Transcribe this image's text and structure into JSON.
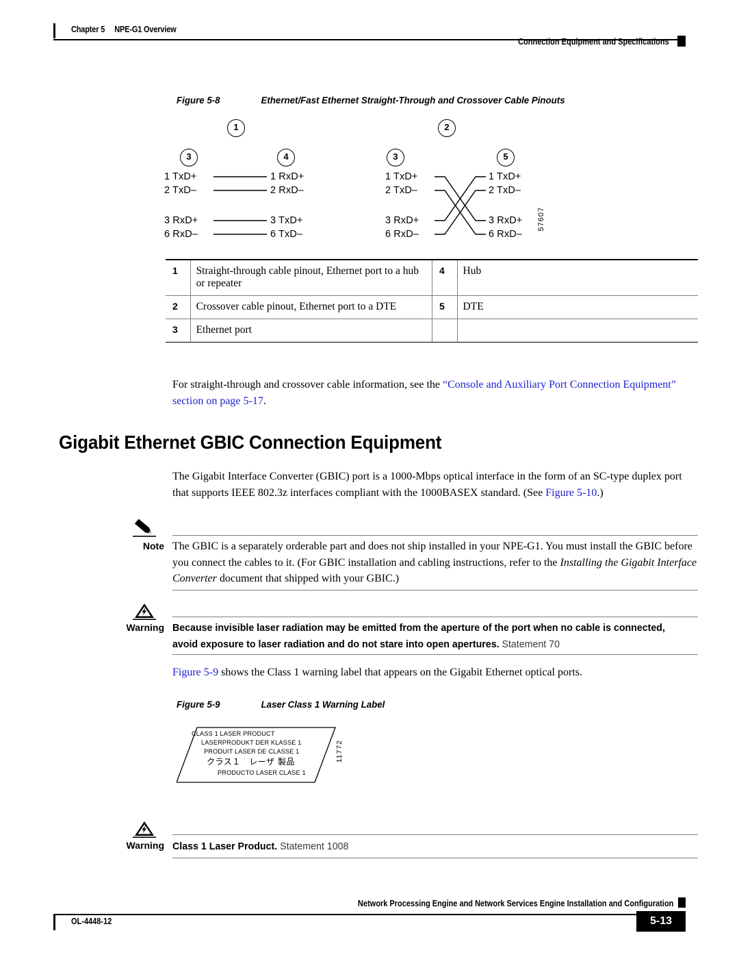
{
  "header": {
    "chapter": "Chapter 5",
    "chapter_title": "NPE-G1 Overview",
    "section": "Connection Equipment and Specifications"
  },
  "figure_58": {
    "number": "Figure 5-8",
    "title": "Ethernet/Fast Ethernet Straight-Through and Crossover Cable Pinouts",
    "artwork_id": "57607",
    "callouts": {
      "straight_through": "1",
      "crossover": "2",
      "left_port_a": "3",
      "right_hub": "4",
      "left_port_b": "3",
      "right_dte": "5"
    },
    "straight_through_pairs": [
      {
        "left": "1 TxD+",
        "right": "1 RxD+"
      },
      {
        "left": "2 TxD–",
        "right": "2 RxD–"
      },
      {
        "left": "3 RxD+",
        "right": "3 TxD+"
      },
      {
        "left": "6 RxD–",
        "right": "6 TxD–"
      }
    ],
    "crossover_pairs": [
      {
        "left": "1 TxD+",
        "right": "1 TxD+"
      },
      {
        "left": "2 TxD–",
        "right": "2 TxD–"
      },
      {
        "left": "3 RxD+",
        "right": "3 RxD+"
      },
      {
        "left": "6 RxD–",
        "right": "6 RxD–"
      }
    ],
    "legend": [
      {
        "n1": "1",
        "t1": "Straight-through cable pinout, Ethernet port to a hub or repeater",
        "n2": "4",
        "t2": "Hub"
      },
      {
        "n1": "2",
        "t1": "Crossover cable pinout, Ethernet port to a DTE",
        "n2": "5",
        "t2": "DTE"
      },
      {
        "n1": "3",
        "t1": "Ethernet port",
        "n2": "",
        "t2": ""
      }
    ]
  },
  "xref_para": {
    "lead": "For straight-through and crossover cable information, see the ",
    "link": "“Console and Auxiliary Port Connection Equipment” section on page 5-17",
    "tail": "."
  },
  "heading": "Gigabit Ethernet GBIC Connection Equipment",
  "gbic_para": {
    "text": "The Gigabit Interface Converter (GBIC) port is a 1000-Mbps optical interface in the form of an SC-type duplex port that supports IEEE 802.3z interfaces compliant with the 1000BASEX standard. (See ",
    "link": "Figure 5-10",
    "tail": ".)"
  },
  "note": {
    "label": "Note",
    "icon": "pencil-icon",
    "text_1": "The GBIC is a separately orderable part and does not ship installed in your NPE-G1. You must install the GBIC before you connect the cables to it. (For GBIC installation and cabling instructions, refer to the ",
    "italic": "Installing the Gigabit Interface Converter",
    "text_2": " document that shipped with your GBIC.)"
  },
  "warning_70": {
    "label": "Warning",
    "icon": "warning-triangle-icon",
    "bold": "Because invisible laser radiation may be emitted from the aperture of the port when no cable is connected, avoid exposure to laser radiation and do not stare into open apertures.",
    "statement": " Statement 70"
  },
  "figure_59_intro": {
    "link": "Figure 5-9",
    "text": " shows the Class 1 warning label that appears on the Gigabit Ethernet optical ports."
  },
  "figure_59": {
    "number": "Figure 5-9",
    "title": "Laser Class 1 Warning Label",
    "artwork_id": "11772",
    "label_lines": [
      "CLASS 1 LASER PRODUCT",
      "LASERPRODUKT DER KLASSE 1",
      "PRODUIT LASER DE CLASSE 1",
      "クラス１　レーザ 製品",
      "PRODUCTO LASER CLASE 1"
    ]
  },
  "warning_1008": {
    "label": "Warning",
    "icon": "warning-triangle-icon",
    "bold": "Class 1 Laser Product.",
    "statement": " Statement 1008"
  },
  "footer": {
    "doc_title": "Network Processing Engine and Network Services Engine Installation and Configuration",
    "doc_number": "OL-4448-12",
    "page_number": "5-13"
  },
  "colors": {
    "link": "#2020d0",
    "rule": "#808080",
    "text": "#000000"
  }
}
